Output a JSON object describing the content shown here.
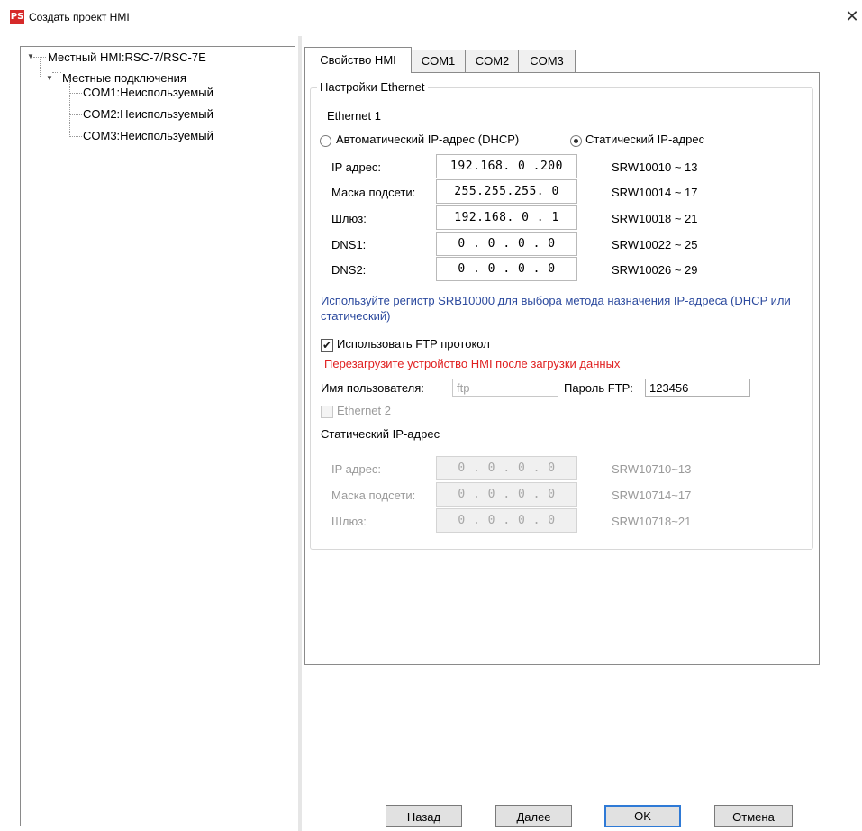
{
  "window": {
    "title": "Создать проект HMI",
    "app_icon_text": "PS",
    "close_glyph": "✕",
    "brand_color": "#d62a2a"
  },
  "tree": {
    "root": "Местный HMI:RSC-7/RSC-7E",
    "connections": "Местные подключения",
    "items": [
      "COM1:Неиспользуемый",
      "COM2:Неиспользуемый",
      "COM3:Неиспользуемый"
    ]
  },
  "tabs": [
    {
      "label": "Свойство HMI",
      "active": true
    },
    {
      "label": "COM1",
      "active": false
    },
    {
      "label": "COM2",
      "active": false
    },
    {
      "label": "COM3",
      "active": false
    }
  ],
  "ethernet": {
    "group_title": "Настройки Ethernet",
    "eth1_label": "Ethernet 1",
    "dhcp_label": "Автоматический IP-адрес (DHCP)",
    "static_label": "Статический IP-адрес",
    "selected_mode": "static",
    "fields": [
      {
        "label": "IP адрес:",
        "value": "192.168. 0 .200",
        "reg": "SRW10010 ~ 13"
      },
      {
        "label": "Маска подсети:",
        "value": "255.255.255. 0",
        "reg": "SRW10014 ~ 17"
      },
      {
        "label": "Шлюз:",
        "value": "192.168. 0 . 1",
        "reg": "SRW10018 ~ 21"
      },
      {
        "label": "DNS1:",
        "value": "0 . 0 . 0 . 0",
        "reg": "SRW10022 ~ 25"
      },
      {
        "label": "DNS2:",
        "value": "0 . 0 . 0 . 0",
        "reg": "SRW10026 ~ 29"
      }
    ],
    "note": "Используйте регистр SRB10000 для выбора метода назначения IP-адреса (DHCP или статический)",
    "ftp_checkbox_label": "Использовать FTP протокол",
    "ftp_checked": true,
    "ftp_warning": "Перезагрузите устройство HMI после загрузки данных",
    "username_label": "Имя пользователя:",
    "username_value": "ftp",
    "password_label": "Пароль FTP:",
    "password_value": "123456",
    "eth2_label": "Ethernet 2",
    "eth2_checked": false,
    "eth2_static_title": "Статический IP-адрес",
    "eth2_fields": [
      {
        "label": "IP адрес:",
        "value": "0 . 0 . 0 . 0",
        "reg": "SRW10710~13"
      },
      {
        "label": "Маска подсети:",
        "value": "0 . 0 . 0 . 0",
        "reg": "SRW10714~17"
      },
      {
        "label": "Шлюз:",
        "value": "0 . 0 . 0 . 0",
        "reg": "SRW10718~21"
      }
    ]
  },
  "buttons": {
    "back": "Назад",
    "next": "Далее",
    "ok": "OK",
    "cancel": "Отмена"
  }
}
